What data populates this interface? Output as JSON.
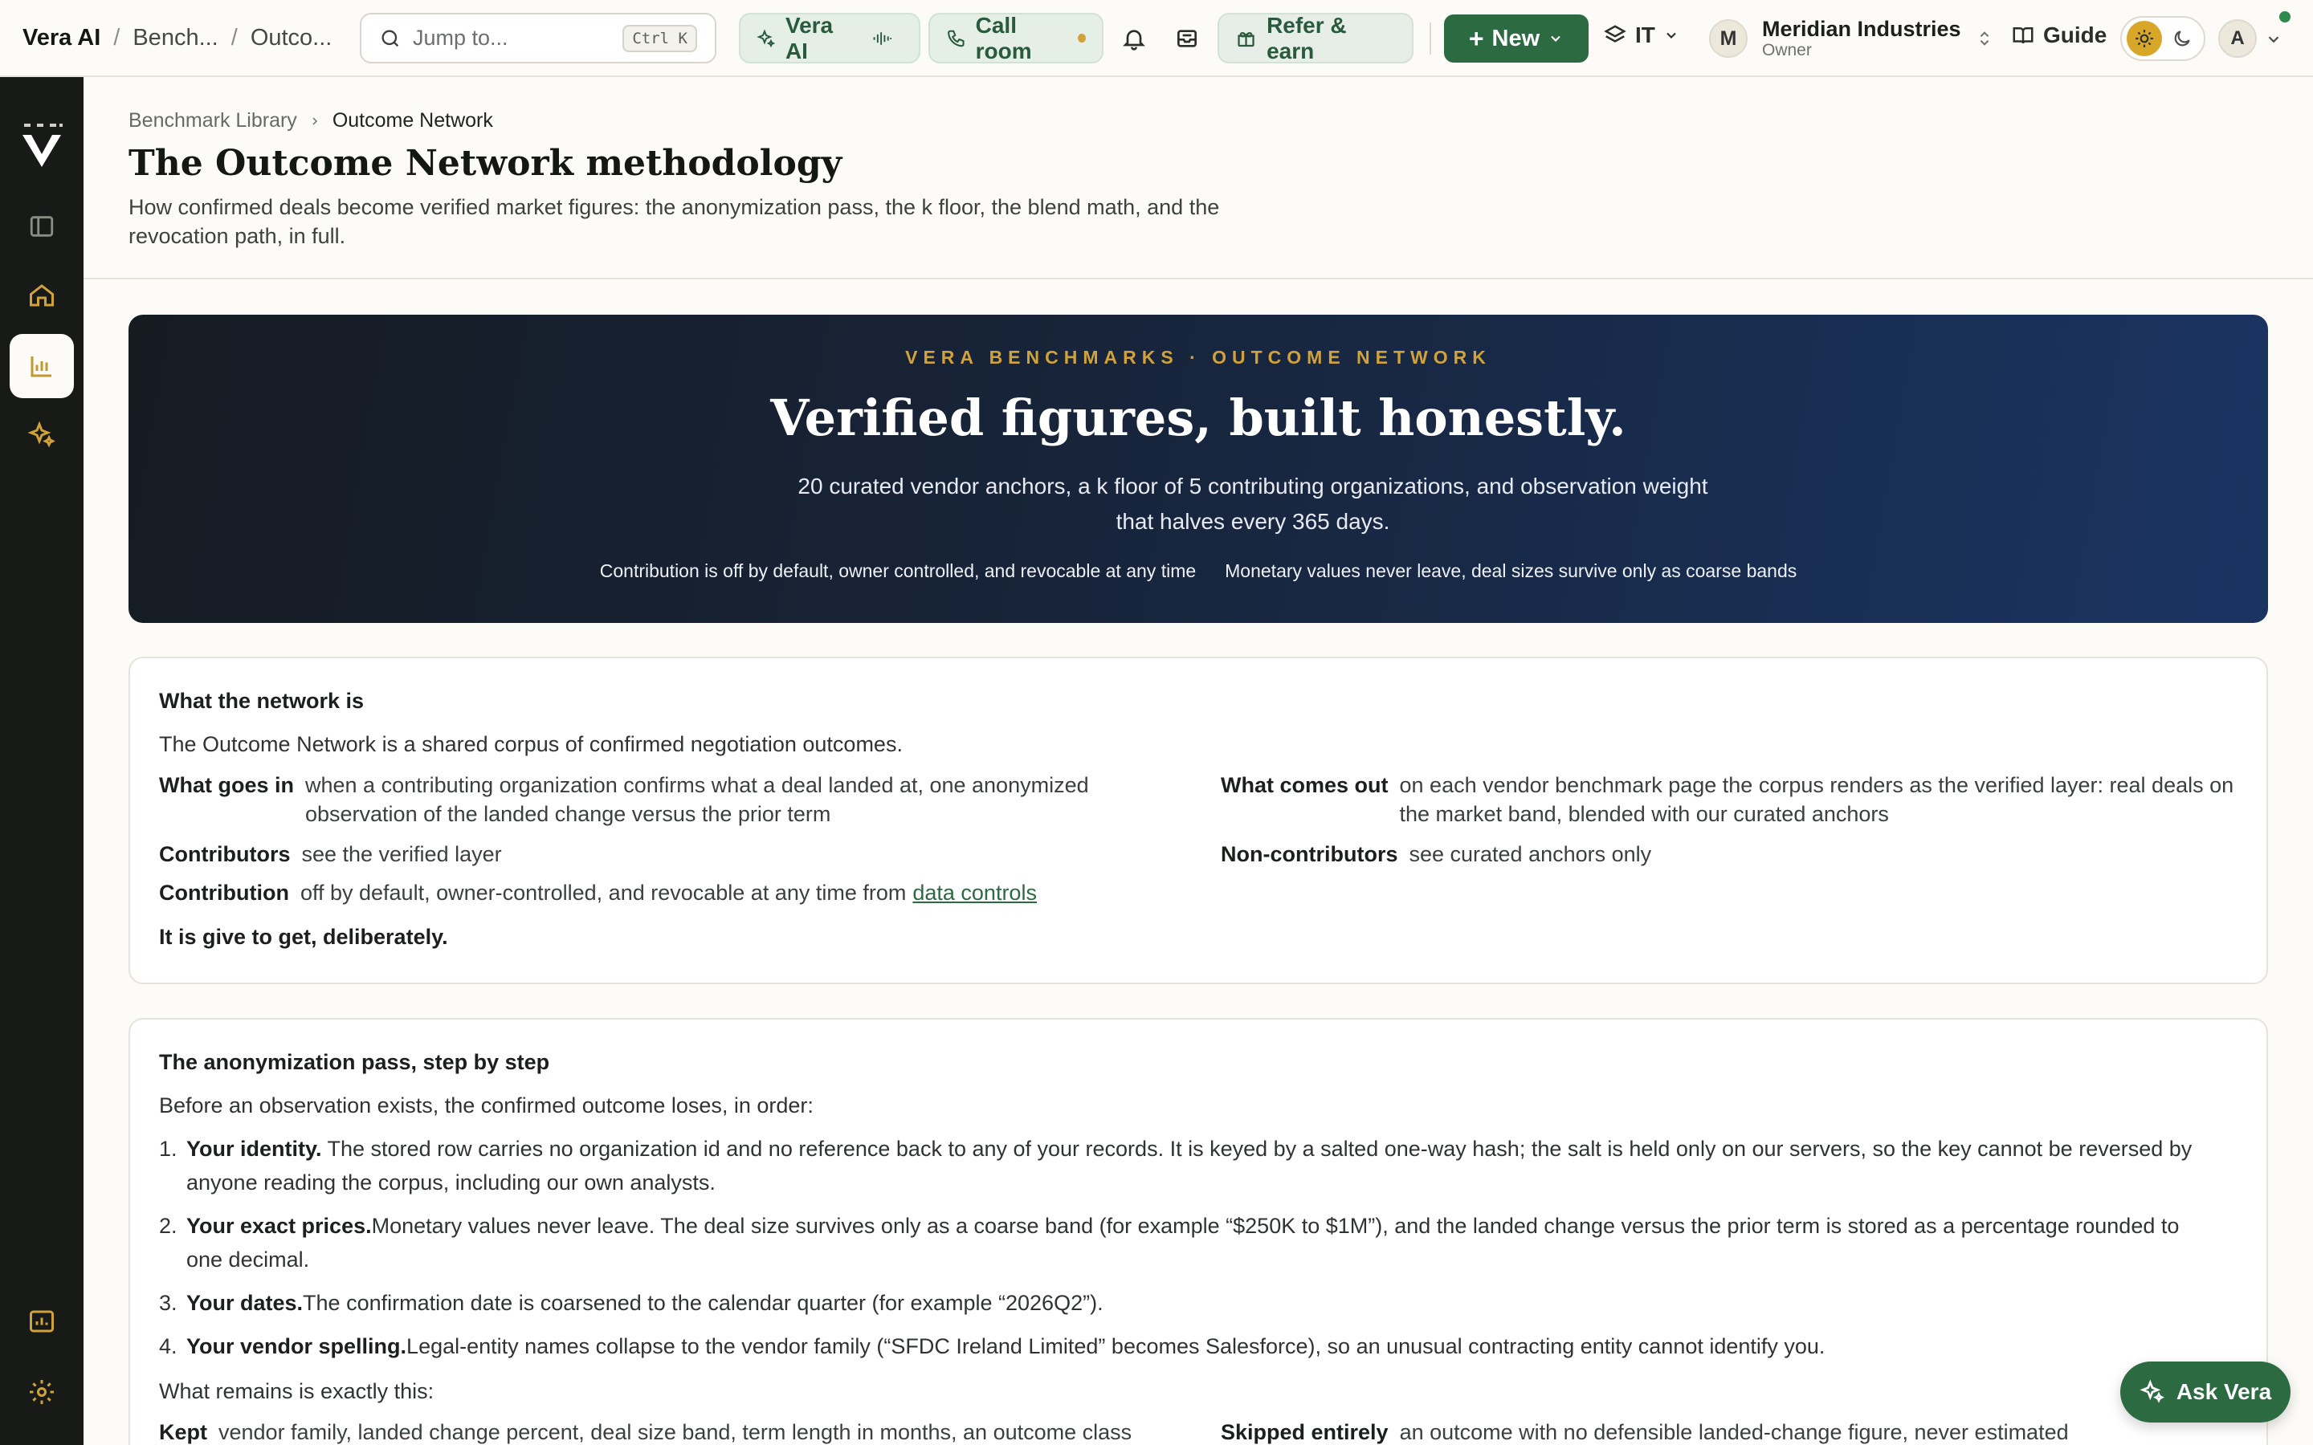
{
  "topbar": {
    "app_name": "Vera AI",
    "crumb_1": "Bench...",
    "crumb_2": "Outco...",
    "search_placeholder": "Jump to...",
    "search_shortcut": "Ctrl K",
    "vera_ai_label": "Vera AI",
    "call_room_label": "Call room",
    "refer_label": "Refer & earn",
    "new_label": "New",
    "workspace_label": "IT",
    "org_initial": "M",
    "org_name": "Meridian Industries",
    "org_role": "Owner",
    "guide_label": "Guide",
    "user_initial": "A"
  },
  "breadcrumb": {
    "parent": "Benchmark Library",
    "current": "Outcome Network"
  },
  "page": {
    "title": "The Outcome Network methodology",
    "subtitle": "How confirmed deals become verified market figures: the anonymization pass, the k floor, the blend math, and the revocation path, in full."
  },
  "hero": {
    "eyebrow": "VERA BENCHMARKS · OUTCOME NETWORK",
    "headline": "Verified figures, built honestly.",
    "description": "20 curated vendor anchors, a k floor of 5 contributing organizations, and observation weight that halves every 365 days.",
    "note_1": "Contribution is off by default, owner controlled, and revocable at any time",
    "note_2": "Monetary values never leave, deal sizes survive only as coarse bands"
  },
  "network_card": {
    "heading": "What the network is",
    "intro": "The Outcome Network is a shared corpus of confirmed negotiation outcomes.",
    "goes_in_key": "What goes in",
    "goes_in_val": "when a contributing organization confirms what a deal landed at, one anonymized observation of the landed change versus the prior term",
    "comes_out_key": "What comes out",
    "comes_out_val": "on each vendor benchmark page the corpus renders as the verified layer: real deals on the market band, blended with our curated anchors",
    "contributors_key": "Contributors",
    "contributors_val": "see the verified layer",
    "noncontributors_key": "Non-contributors",
    "noncontributors_val": "see curated anchors only",
    "contribution_key": "Contribution",
    "contribution_val": "off by default, owner-controlled, and revocable at any time from",
    "contribution_link": "data controls",
    "closing": "It is give to get, deliberately."
  },
  "anon_card": {
    "heading": "The anonymization pass, step by step",
    "intro": "Before an observation exists, the confirmed outcome loses, in order:",
    "steps": [
      {
        "num": "1.",
        "title": "Your identity.",
        "text": " The stored row carries no organization id and no reference back to any of your records. It is keyed by a salted one-way hash; the salt is held only on our servers, so the key cannot be reversed by anyone reading the corpus, including our own analysts."
      },
      {
        "num": "2.",
        "title": "Your exact prices.",
        "text": "Monetary values never leave. The deal size survives only as a coarse band (for example “$250K to $1M”), and the landed change versus the prior term is stored as a percentage rounded to one decimal."
      },
      {
        "num": "3.",
        "title": "Your dates.",
        "text": "The confirmation date is coarsened to the calendar quarter (for example “2026Q2”)."
      },
      {
        "num": "4.",
        "title": "Your vendor spelling.",
        "text": "Legal-entity names collapse to the vendor family (“SFDC Ireland Limited” becomes Salesforce), so an unusual contracting entity cannot identify you."
      }
    ],
    "remains": "What remains is exactly this:",
    "kept_key": "Kept",
    "kept_val": "vendor family, landed change percent, deal size band, term length in months, an outcome class",
    "skipped_key": "Skipped entirely",
    "skipped_val": "an outcome with no defensible landed-change figure, never estimated"
  },
  "ask_vera": {
    "label": "Ask Vera"
  },
  "colors": {
    "accent": "#2c6a42",
    "sidebar": "#171a16",
    "gold": "#d2a23a"
  }
}
